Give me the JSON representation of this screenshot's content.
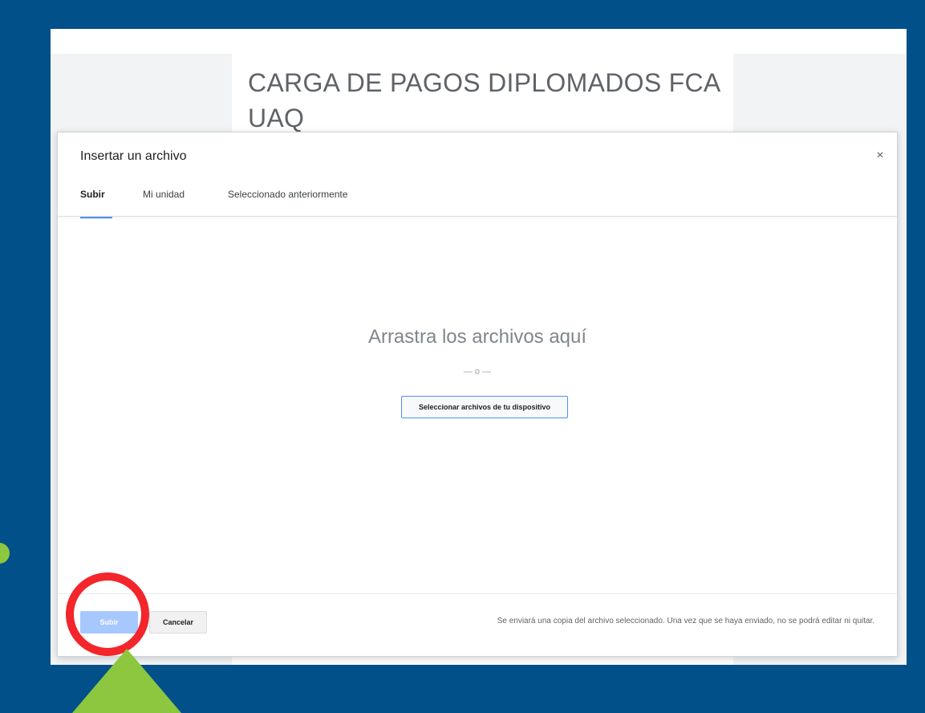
{
  "form": {
    "title": "CARGA DE PAGOS DIPLOMADOS FCA UAQ"
  },
  "dialog": {
    "title": "Insertar un archivo",
    "close_label": "×",
    "tabs": [
      {
        "label": "Subir",
        "active": true
      },
      {
        "label": "Mi unidad",
        "active": false
      },
      {
        "label": "Seleccionado anteriormente",
        "active": false
      }
    ],
    "drop_text": "Arrastra los archivos aquí",
    "or_separator": "— o —",
    "select_files_label": "Seleccionar archivos de tu dispositivo",
    "upload_label": "Subir",
    "cancel_label": "Cancelar",
    "footer_note": "Se enviará una copia del archivo seleccionado. Una vez que se haya enviado, no se podrá editar ni quitar."
  },
  "colors": {
    "frame": "#02508a",
    "accent_blue": "#4d90fe",
    "upload_disabled": "#a6c8ff",
    "highlight_red": "#f2262b",
    "arrow_green": "#8dc63f"
  },
  "icons": {
    "close": "close-icon"
  }
}
